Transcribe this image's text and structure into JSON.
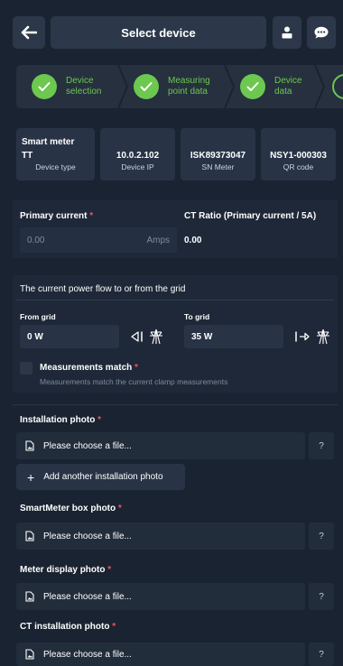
{
  "header": {
    "title": "Select device",
    "back_icon": "arrow-left-icon",
    "user_icon": "user-icon",
    "chat_icon": "chat-icon"
  },
  "steps": [
    {
      "label_line1": "Device",
      "label_line2": "selection",
      "status": "complete"
    },
    {
      "label_line1": "Measuring",
      "label_line2": "point data",
      "status": "complete"
    },
    {
      "label_line1": "Device",
      "label_line2": "data",
      "status": "complete"
    }
  ],
  "device_info": {
    "meter_title": "Smart meter",
    "items": [
      {
        "value": "TT",
        "caption": "Device type"
      },
      {
        "value": "10.0.2.102",
        "caption": "Device IP"
      },
      {
        "value": "ISK89373047",
        "caption": "SN Meter"
      },
      {
        "value": "NSY1-000303",
        "caption": "QR code"
      }
    ]
  },
  "current": {
    "primary_label": "Primary current",
    "required_mark": "*",
    "primary_placeholder": "0.00",
    "primary_unit": "Amps",
    "ct_label": "CT Ratio (Primary current / 5A)",
    "ct_value": "0.00"
  },
  "power_flow": {
    "title": "The current power flow to or from the grid",
    "from_label": "From grid",
    "from_value": "0 W",
    "to_label": "To grid",
    "to_value": "35 W",
    "match_label": "Measurements match",
    "match_hint": "Measurements match the current clamp measurements"
  },
  "uploads": {
    "choose_text": "Please choose a file...",
    "help_text": "?",
    "add_another": "Add another installation photo",
    "add_icon": "+",
    "items": [
      {
        "label": "Installation photo"
      },
      {
        "label": "SmartMeter box photo"
      },
      {
        "label": "Meter display photo"
      },
      {
        "label": "CT installation photo"
      }
    ]
  },
  "colors": {
    "background": "#1a2331",
    "accent_green": "#6cc84f",
    "required_red": "#ff4d5a"
  }
}
